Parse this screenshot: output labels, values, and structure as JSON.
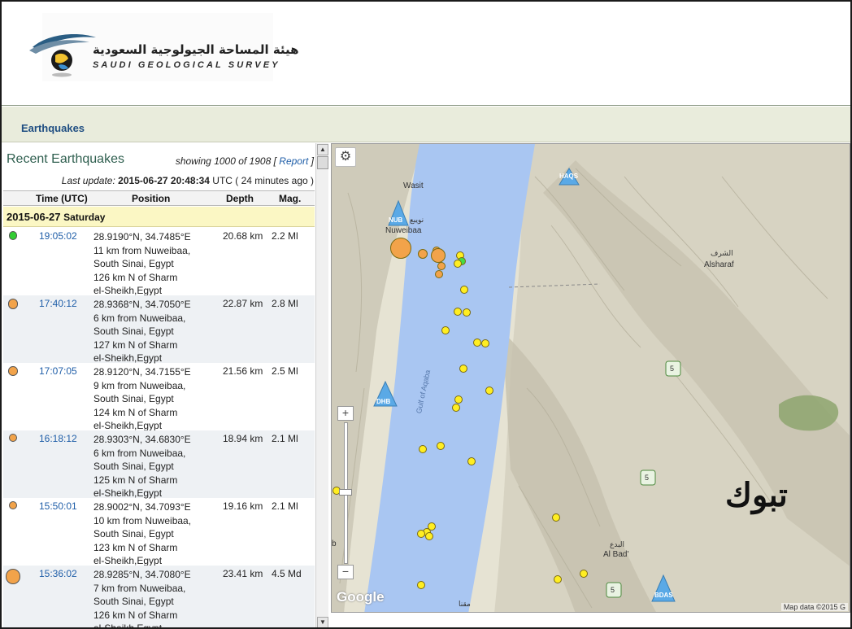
{
  "header": {
    "logo_arabic": "هيئة المساحة الجيولوجية السعودية",
    "logo_english": "SAUDI GEOLOGICAL SURVEY"
  },
  "nav": {
    "earthquakes": "Earthquakes"
  },
  "list": {
    "title": "Recent Earthquakes",
    "showing_prefix": "showing 1000 of 1908 [",
    "report_link": "Report",
    "showing_suffix": "]",
    "update_label": "Last update:",
    "update_time": "2015-06-27 20:48:34",
    "update_suffix": "UTC ( 24 minutes ago )",
    "columns": {
      "time": "Time (UTC)",
      "position": "Position",
      "depth": "Depth",
      "mag": "Mag."
    },
    "date": "2015-06-27",
    "weekday": "Saturday",
    "rows": [
      {
        "time": "19:05:02",
        "coords": "28.9190°N, 34.7485°E",
        "l1": "11 km from Nuweibaa,",
        "l2": "South Sinai, Egypt",
        "l3": "126 km N of Sharm",
        "l4": "el-Sheikh,Egypt",
        "depth": "20.68 km",
        "mag": "2.2 Ml",
        "color": "#33cc33",
        "mag_value": 2.2
      },
      {
        "time": "17:40:12",
        "coords": "28.9368°N, 34.7050°E",
        "l1": "6 km from Nuweibaa,",
        "l2": "South Sinai, Egypt",
        "l3": "127 km N of Sharm",
        "l4": "el-Sheikh,Egypt",
        "depth": "22.87 km",
        "mag": "2.8 Ml",
        "color": "#f2a34a",
        "mag_value": 2.8
      },
      {
        "time": "17:07:05",
        "coords": "28.9120°N, 34.7155°E",
        "l1": "9 km from Nuweibaa,",
        "l2": "South Sinai, Egypt",
        "l3": "124 km N of Sharm",
        "l4": "el-Sheikh,Egypt",
        "depth": "21.56 km",
        "mag": "2.5 Ml",
        "color": "#f2a34a",
        "mag_value": 2.5
      },
      {
        "time": "16:18:12",
        "coords": "28.9303°N, 34.6830°E",
        "l1": "6 km from Nuweibaa,",
        "l2": "South Sinai, Egypt",
        "l3": "125 km N of Sharm",
        "l4": "el-Sheikh,Egypt",
        "depth": "18.94 km",
        "mag": "2.1 Ml",
        "color": "#f2a34a",
        "mag_value": 2.1
      },
      {
        "time": "15:50:01",
        "coords": "28.9002°N, 34.7093°E",
        "l1": "10 km from Nuweibaa,",
        "l2": "South Sinai, Egypt",
        "l3": "123 km N of Sharm",
        "l4": "el-Sheikh,Egypt",
        "depth": "19.16 km",
        "mag": "2.1 Ml",
        "color": "#f2a34a",
        "mag_value": 2.1
      },
      {
        "time": "15:36:02",
        "coords": "28.9285°N, 34.7080°E",
        "l1": "7 km from Nuweibaa,",
        "l2": "South Sinai, Egypt",
        "l3": "126 km N of Sharm",
        "l4": "el-Sheikh,Egypt",
        "depth": "23.41 km",
        "mag": "4.5 Md",
        "color": "#f2a34a",
        "mag_value": 4.5
      }
    ]
  },
  "map": {
    "labels": {
      "wasit": "Wasit",
      "nuweibaa": "Nuweibaa",
      "nuweibaa_ar": "نويبع",
      "alsharaf": "Alsharaf",
      "alsharaf_ar": "الشرف",
      "gulf": "Gulf of Aqaba",
      "albad": "Al Bad'",
      "albad_ar": "البدع",
      "maqna_ar": "مقنا",
      "tabuk": "تبوك",
      "b": "b"
    },
    "stations": {
      "haqs": "HAQS",
      "nub": "NUB",
      "dhb": "DHB",
      "bdas": "BDAS"
    },
    "road": "5",
    "google": "Google",
    "attribution": "Map data ©2015 G",
    "colors": {
      "land": "#e8e6d6",
      "sea": "#a9c6f2",
      "mountain": "#c9c5b3"
    }
  }
}
